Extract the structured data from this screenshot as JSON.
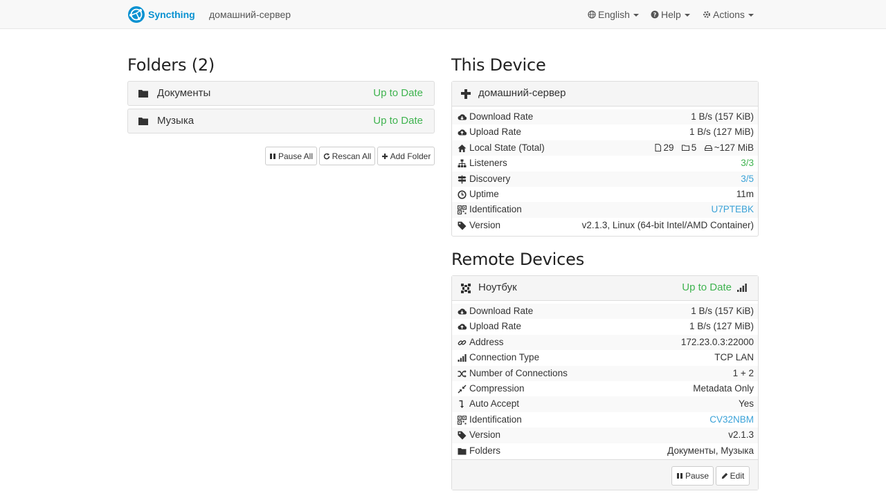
{
  "navbar": {
    "brand": "Syncthing",
    "device_name": "домашний-сервер",
    "language": "English",
    "help": "Help",
    "actions": "Actions"
  },
  "folders": {
    "title": "Folders (2)",
    "items": [
      {
        "name": "Документы",
        "status": "Up to Date"
      },
      {
        "name": "Музыка",
        "status": "Up to Date"
      }
    ],
    "buttons": {
      "pause_all": "Pause All",
      "rescan_all": "Rescan All",
      "add_folder": "Add Folder"
    }
  },
  "this_device": {
    "title": "This Device",
    "name": "домашний-сервер",
    "rows": [
      {
        "icon": "cloud-download-icon",
        "label": "Download Rate",
        "value": "1 B/s (157 KiB)"
      },
      {
        "icon": "cloud-upload-icon",
        "label": "Upload Rate",
        "value": "1 B/s (127 MiB)"
      },
      {
        "icon": "home-icon",
        "label": "Local State (Total)",
        "files": "29",
        "dirs": "5",
        "size": "~127 MiB"
      },
      {
        "icon": "sitemap-icon",
        "label": "Listeners",
        "value": "3/3"
      },
      {
        "icon": "signpost-icon",
        "label": "Discovery",
        "value": "3/5"
      },
      {
        "icon": "clock-icon",
        "label": "Uptime",
        "value": "11m"
      },
      {
        "icon": "qrcode-icon",
        "label": "Identification",
        "value": "U7PTEBK"
      },
      {
        "icon": "tag-icon",
        "label": "Version",
        "value": "v2.1.3, Linux (64-bit Intel/AMD Container)"
      }
    ]
  },
  "remote_devices": {
    "title": "Remote Devices",
    "items": [
      {
        "name": "Ноутбук",
        "status": "Up to Date",
        "rows": [
          {
            "icon": "cloud-download-icon",
            "label": "Download Rate",
            "value": "1 B/s (157 KiB)"
          },
          {
            "icon": "cloud-upload-icon",
            "label": "Upload Rate",
            "value": "1 B/s (127 MiB)"
          },
          {
            "icon": "link-icon",
            "label": "Address",
            "value": "172.23.0.3:22000"
          },
          {
            "icon": "signal-icon",
            "label": "Connection Type",
            "value": "TCP LAN"
          },
          {
            "icon": "random-icon",
            "label": "Number of Connections",
            "value": "1 + 2"
          },
          {
            "icon": "compress-icon",
            "label": "Compression",
            "value": "Metadata Only"
          },
          {
            "icon": "level-down-icon",
            "label": "Auto Accept",
            "value": "Yes"
          },
          {
            "icon": "qrcode-icon",
            "label": "Identification",
            "value": "CV32NBM"
          },
          {
            "icon": "tag-icon",
            "label": "Version",
            "value": "v2.1.3"
          },
          {
            "icon": "folder-icon",
            "label": "Folders",
            "value": "Документы, Музыка"
          }
        ],
        "buttons": {
          "pause": "Pause",
          "edit": "Edit"
        }
      }
    ]
  },
  "colors": {
    "brand": "#0891d1",
    "status_green": "#3fb34f",
    "link_blue": "#3aa2d8",
    "panel_bg": "#f5f5f5"
  }
}
